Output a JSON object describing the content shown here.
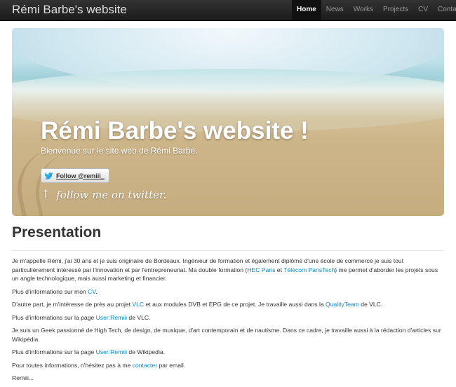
{
  "navbar": {
    "brand": "Rémi Barbe's website",
    "items": [
      {
        "label": "Home",
        "active": true
      },
      {
        "label": "News",
        "active": false
      },
      {
        "label": "Works",
        "active": false
      },
      {
        "label": "Projects",
        "active": false
      },
      {
        "label": "CV",
        "active": false
      },
      {
        "label": "Contact",
        "active": false
      }
    ]
  },
  "hero": {
    "title": "Rémi Barbe's website !",
    "subtitle": "Bienvenue sur le site web de Rémi Barbe.",
    "twitter_button": "Follow @remiii_",
    "follow_note": "follow me on twitter.",
    "follow_arrow": "↑"
  },
  "presentation": {
    "title": "Presentation",
    "p1": {
      "a": "Je m'appelle Rémi, j'ai 30 ans et je suis originaire de Bordeaux. Ingénieur de formation et également diplômé d'une école de commerce je suis tout particulièrement intéressé par l'innovation et par l'entrepreneuriat. Ma double formation (",
      "link1": "HEC Paris",
      "b": " et ",
      "link2": "Télécom ParisTech",
      "c": ") me permet d'aborder les projets sous un angle technologique, mais aussi marketing et financier."
    },
    "p2": {
      "a": "Plus d'informations sur mon ",
      "link": "CV",
      "b": "."
    },
    "p3": {
      "a": "D'autre part, je m'intéresse de près au projet ",
      "link1": "VLC",
      "b": " et aux modules DVB et EPG de ce projet. Je travaille aussi dans la ",
      "link2": "QualityTeam",
      "c": " de VLC."
    },
    "p4": {
      "a": "Plus d'informations sur la page ",
      "link": "User:Remiii",
      "b": " de VLC."
    },
    "p5": "Je suis un Geek passionné de High Tech, de design, de musique, d'art contemporain et de nautisme. Dans ce cadre, je travaille aussi à la rédaction d'articles sur Wikipédia.",
    "p6": {
      "a": "Plus d'informations sur la page ",
      "link": "User:Remiii",
      "b": " de Wikipedia."
    },
    "p7": {
      "a": "Pour toutes informations, n'hésitez pas à me ",
      "link": "contacter",
      "b": " par email."
    },
    "p8": "Remiii..."
  },
  "colors": {
    "link": "#0088cc",
    "navbar": "#1b1b1b"
  },
  "icons": {
    "twitter": "twitter-bird-icon",
    "arrow": "up-arrow-icon"
  }
}
